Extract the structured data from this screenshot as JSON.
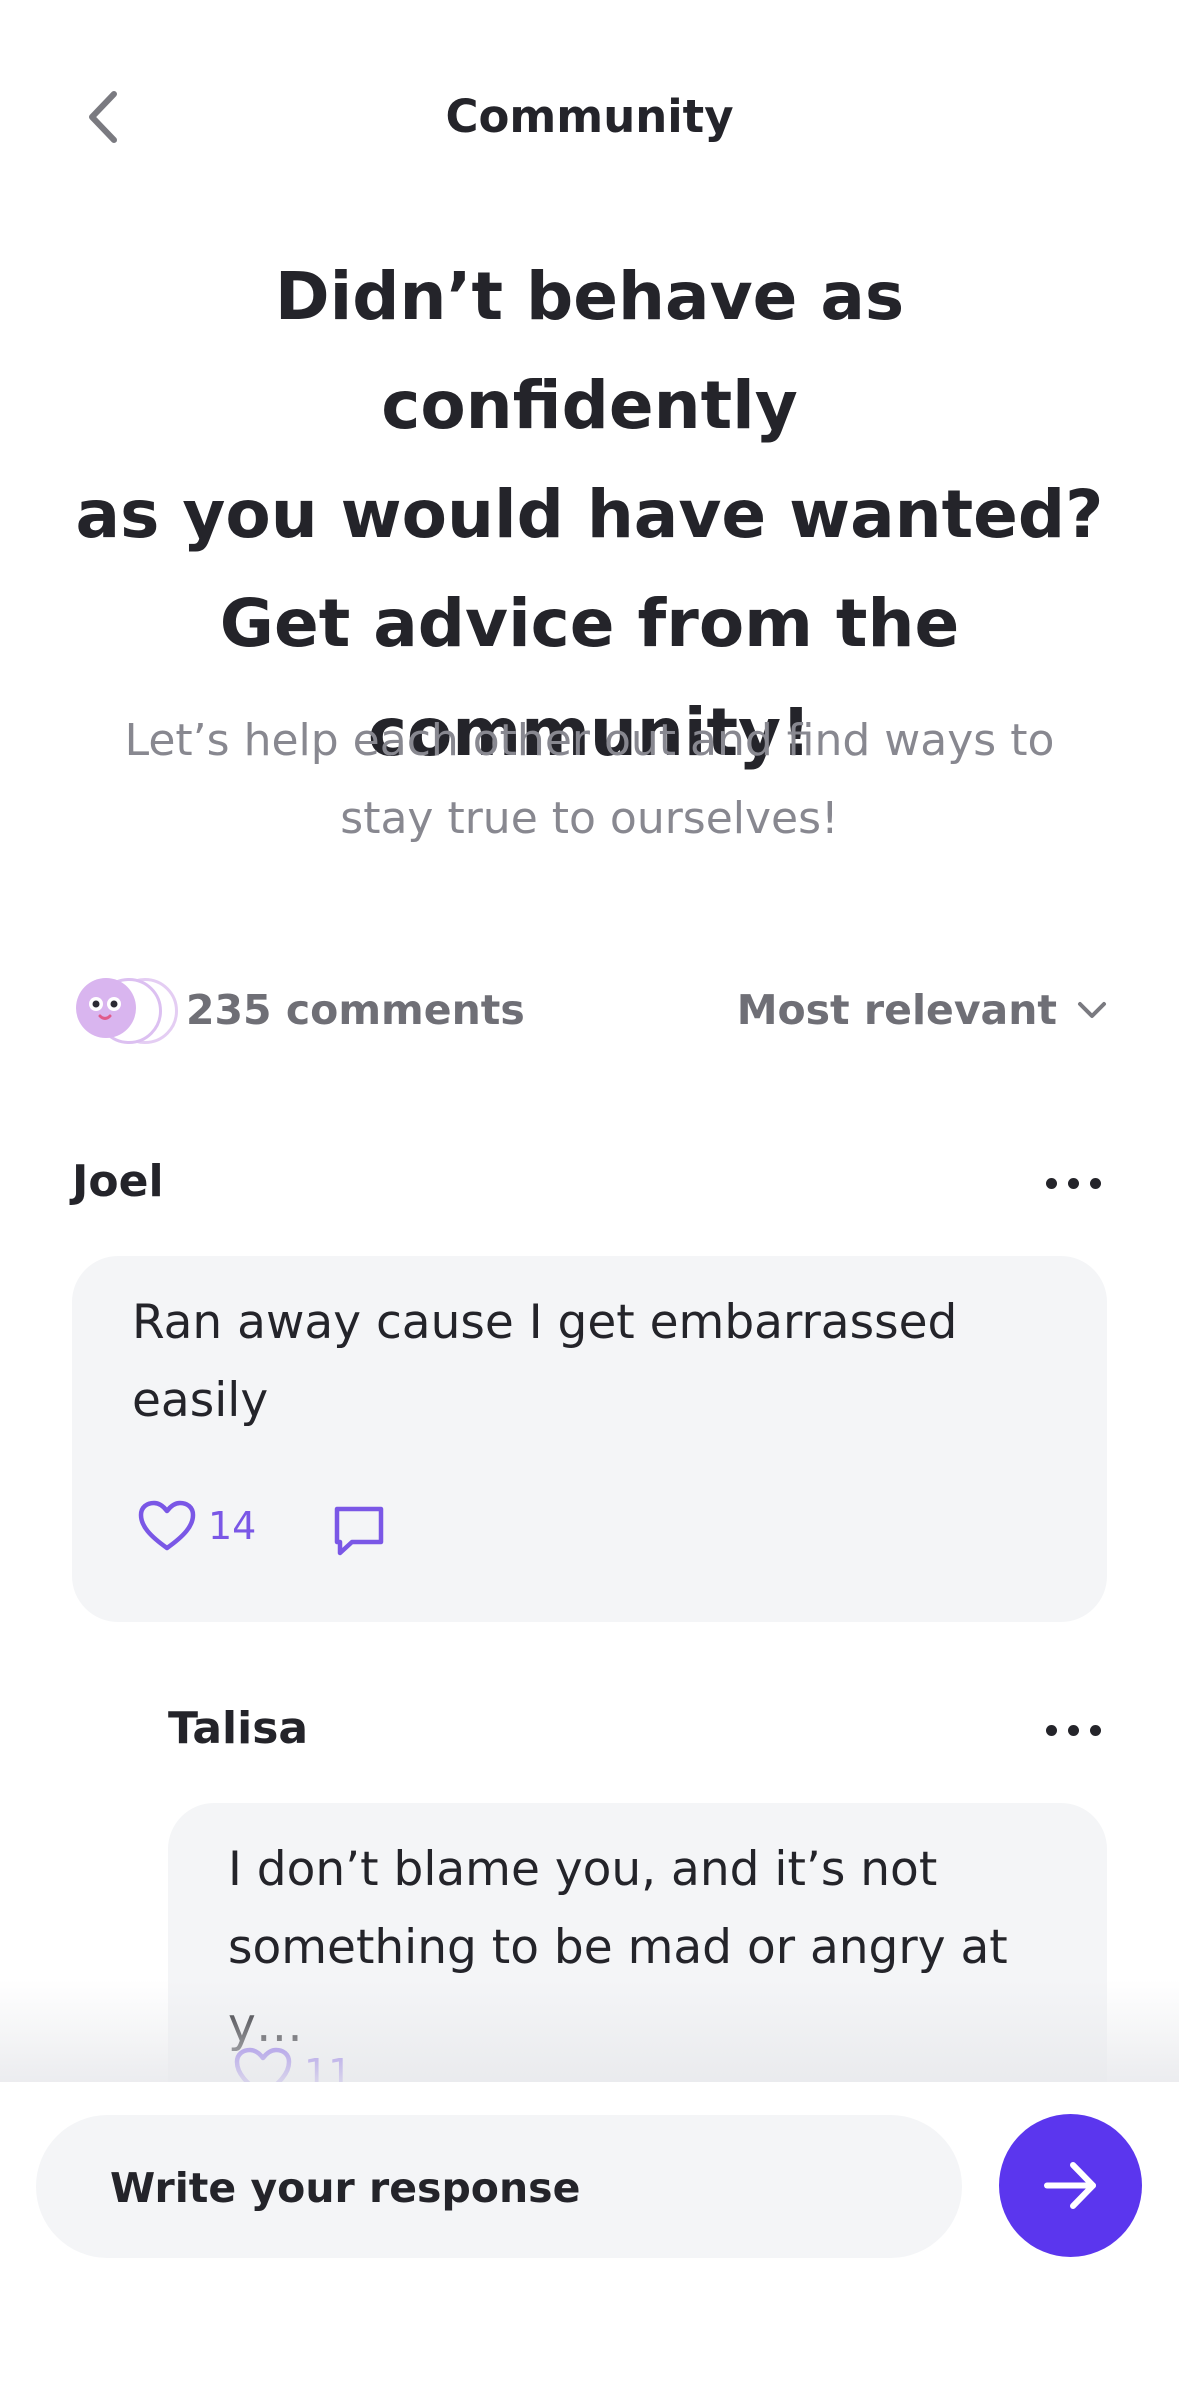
{
  "header": {
    "title": "Community",
    "back_icon": "chevron-left-icon"
  },
  "hero": {
    "title_lines": [
      "Didn’t behave as confidently",
      "as you would have wanted?",
      "Get advice from the",
      "community!"
    ],
    "subtitle_lines": [
      "Let’s help each other out and find ways to",
      "stay true to ourselves!"
    ]
  },
  "comments_meta": {
    "count_label": "235 comments",
    "sort_label": "Most relevant",
    "sort_icon": "chevron-down-icon"
  },
  "comments": [
    {
      "author": "Joel",
      "text_lines": [
        "Ran away cause I get embarrassed",
        "easily"
      ],
      "likes": "14",
      "like_icon": "heart-icon",
      "reply_icon": "comment-icon",
      "more_icon": "more-dots-icon"
    },
    {
      "author": "Talisa",
      "text_lines": [
        "I don’t blame you, and it’s not",
        "something to be mad or angry at y…"
      ],
      "likes": "11",
      "like_icon": "heart-icon",
      "more_icon": "more-dots-icon"
    }
  ],
  "composer": {
    "placeholder": "Write your response",
    "value": "",
    "send_icon": "arrow-right-icon"
  },
  "colors": {
    "accent": "#5b36ee",
    "accent_light": "#7a57e6",
    "card_bg": "#f4f5f7",
    "text": "#24242a",
    "muted": "#888890",
    "avatar": "#d9b5ef"
  }
}
